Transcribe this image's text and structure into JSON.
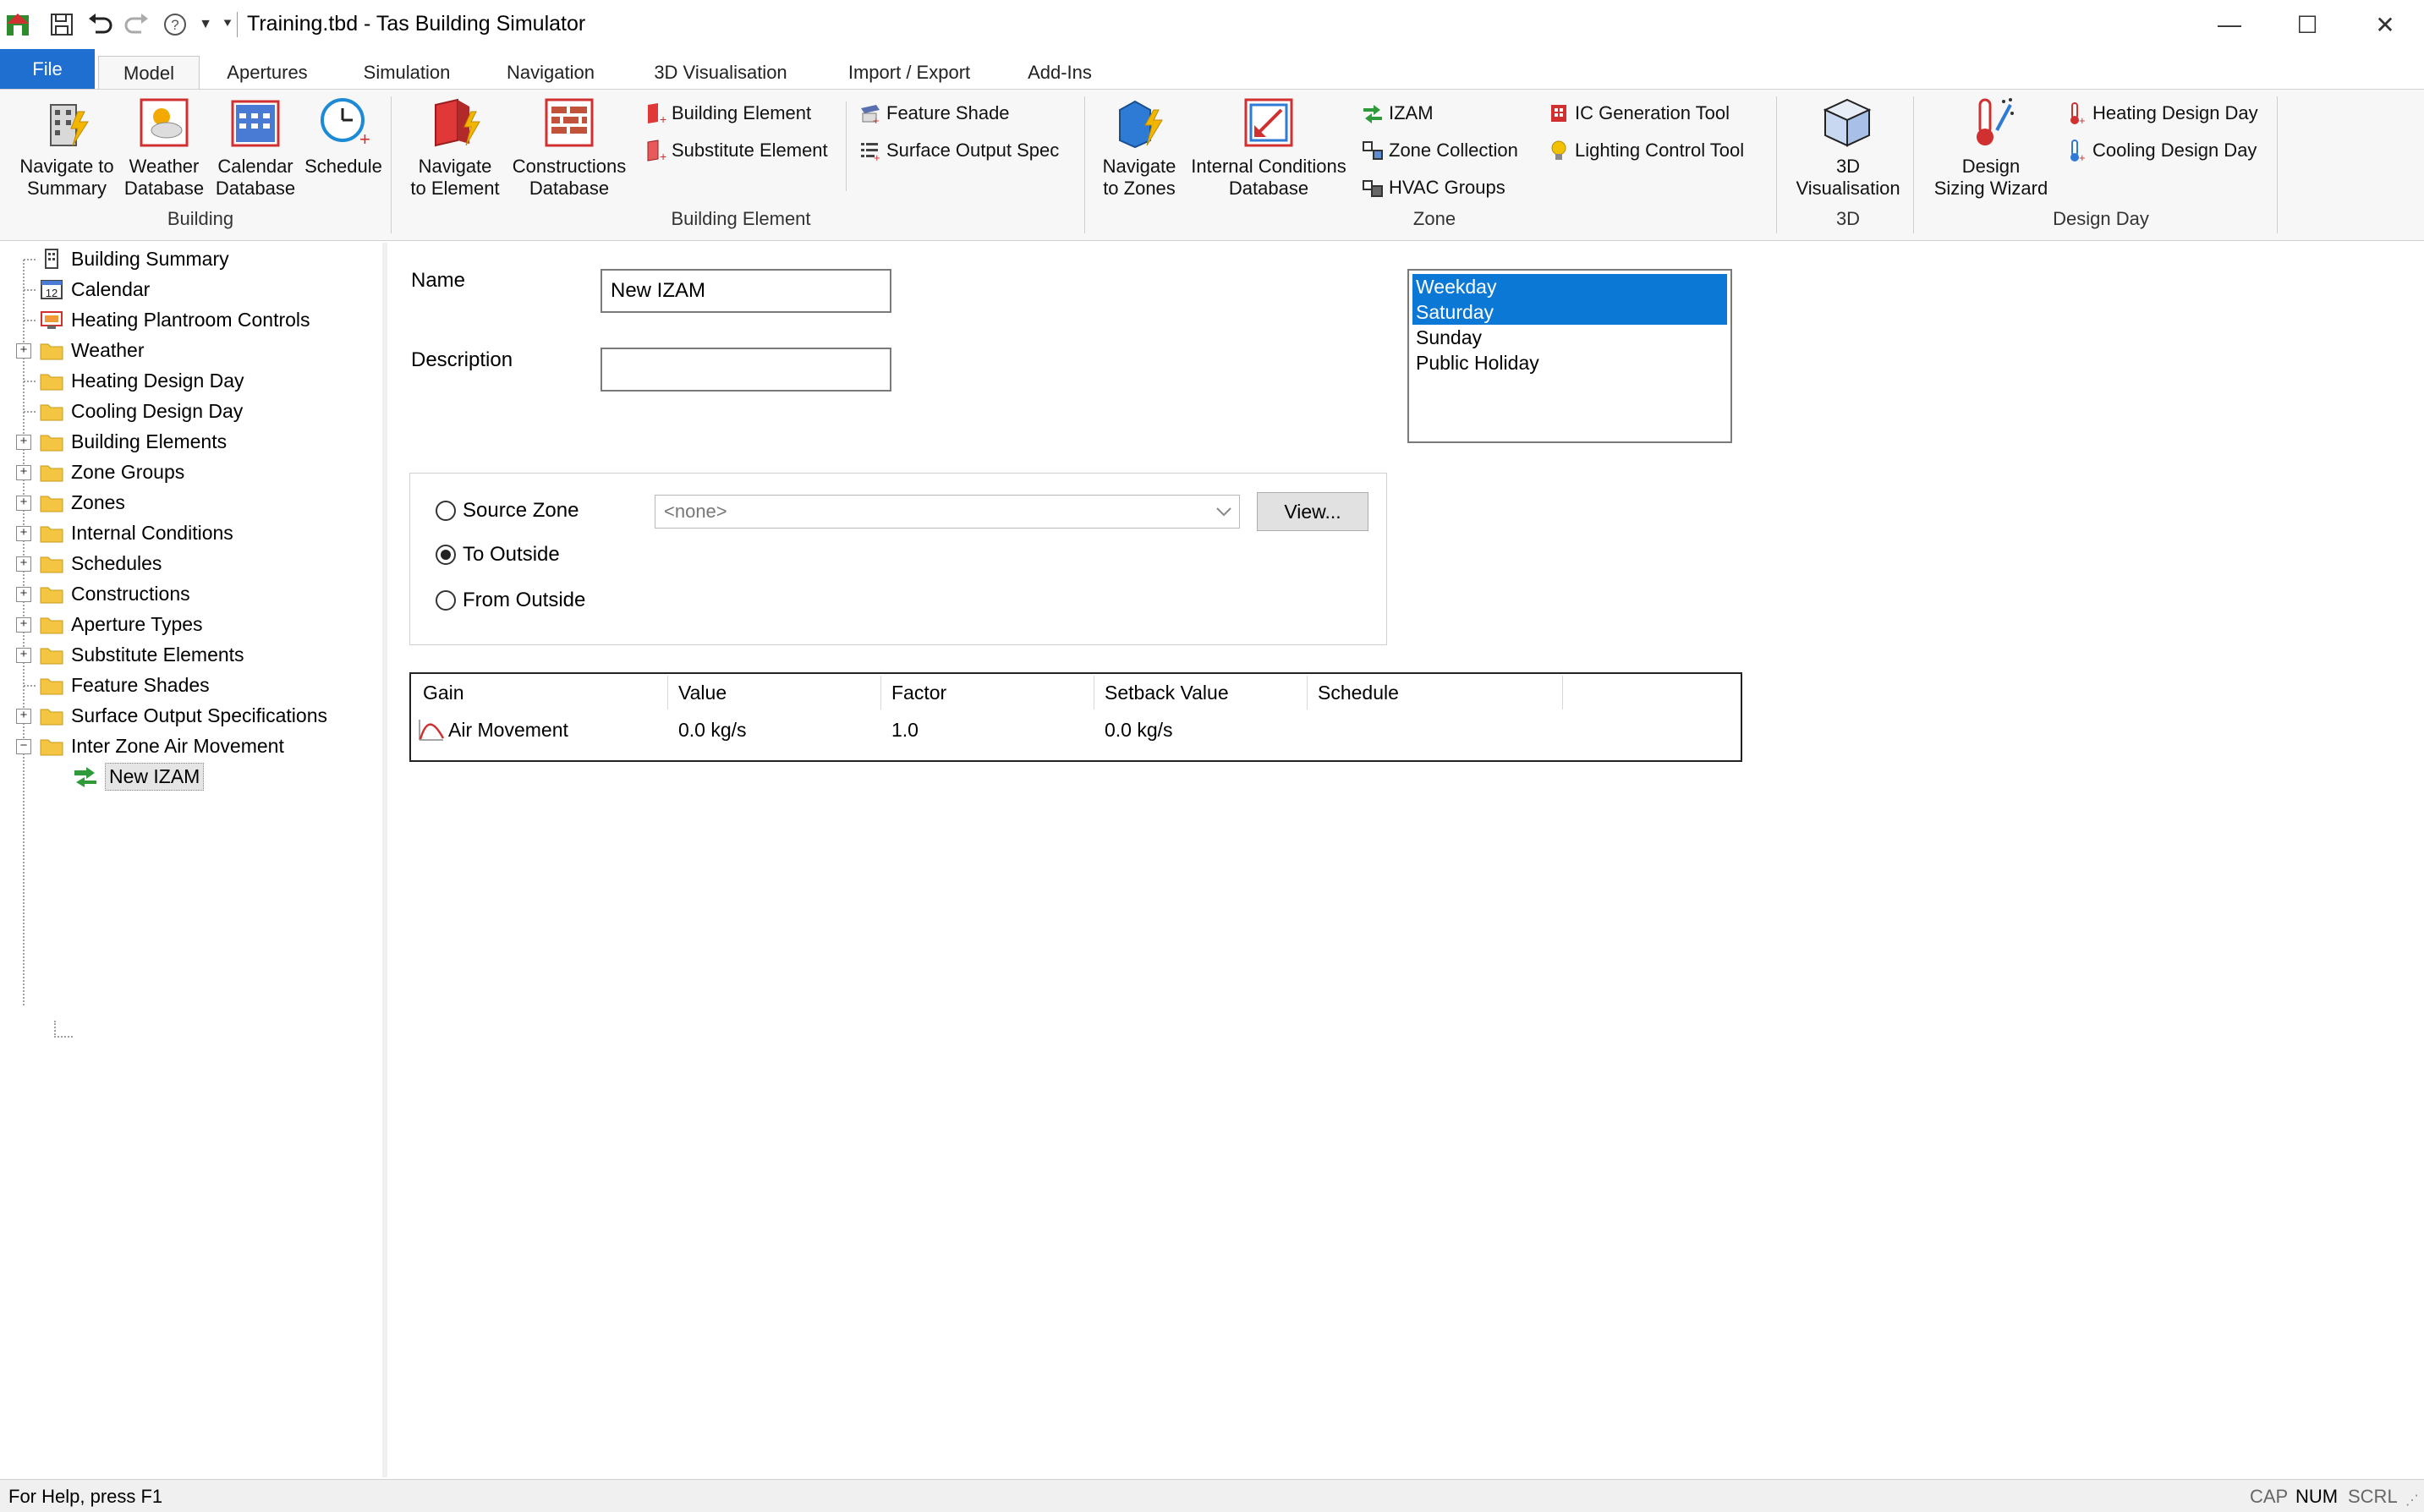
{
  "window": {
    "title": "Training.tbd - Tas Building Simulator"
  },
  "qat": {
    "icons": [
      "app-icon",
      "save-icon",
      "undo-icon",
      "redo-icon",
      "help-icon",
      "dropdown-icon",
      "customize-icon"
    ]
  },
  "window_controls": {
    "minimize": "—",
    "maximize": "☐",
    "close": "✕"
  },
  "tabs": [
    {
      "label": "File"
    },
    {
      "label": "Model"
    },
    {
      "label": "Apertures"
    },
    {
      "label": "Simulation"
    },
    {
      "label": "Navigation"
    },
    {
      "label": "3D Visualisation"
    },
    {
      "label": "Import / Export"
    },
    {
      "label": "Add-Ins"
    }
  ],
  "ribbon": {
    "building": {
      "label": "Building",
      "navigate_summary": [
        "Navigate to",
        "Summary"
      ],
      "weather_db": [
        "Weather",
        "Database"
      ],
      "calendar_db": [
        "Calendar",
        "Database"
      ],
      "schedule": [
        "Schedule",
        ""
      ]
    },
    "building_element": {
      "label": "Building Element",
      "navigate_element": [
        "Navigate",
        "to Element"
      ],
      "constructions_db": [
        "Constructions",
        "Database"
      ],
      "building_element": "Building Element",
      "substitute_element": "Substitute Element",
      "feature_shade": "Feature Shade",
      "surface_output_spec": "Surface Output Spec"
    },
    "zone": {
      "label": "Zone",
      "navigate_zones": [
        "Navigate",
        "to Zones"
      ],
      "internal_conditions_db": [
        "Internal Conditions",
        "Database"
      ],
      "izam": "IZAM",
      "zone_collection": "Zone Collection",
      "hvac_groups": "HVAC Groups",
      "ic_generation_tool": "IC Generation Tool",
      "lighting_control_tool": "Lighting Control Tool"
    },
    "three_d": {
      "label": "3D",
      "visualisation": [
        "3D",
        "Visualisation"
      ]
    },
    "design_day": {
      "label": "Design Day",
      "sizing_wizard": [
        "Design",
        "Sizing Wizard"
      ],
      "heating_design_day": "Heating Design Day",
      "cooling_design_day": "Cooling Design Day"
    }
  },
  "tree": {
    "items": [
      {
        "label": "Building Summary"
      },
      {
        "label": "Calendar"
      },
      {
        "label": "Heating Plantroom Controls"
      },
      {
        "label": "Weather"
      },
      {
        "label": "Heating Design Day"
      },
      {
        "label": "Cooling Design Day"
      },
      {
        "label": "Building Elements"
      },
      {
        "label": "Zone Groups"
      },
      {
        "label": "Zones"
      },
      {
        "label": "Internal Conditions"
      },
      {
        "label": "Schedules"
      },
      {
        "label": "Constructions"
      },
      {
        "label": "Aperture Types"
      },
      {
        "label": "Substitute Elements"
      },
      {
        "label": "Feature Shades"
      },
      {
        "label": "Surface Output Specifications"
      },
      {
        "label": "Inter Zone Air Movement"
      },
      {
        "label": "New IZAM"
      }
    ],
    "calendar_badge": "12"
  },
  "form": {
    "name_label": "Name",
    "name_value": "New IZAM",
    "description_label": "Description",
    "description_value": "",
    "days": [
      {
        "label": "Weekday",
        "selected": true
      },
      {
        "label": "Saturday",
        "selected": true
      },
      {
        "label": "Sunday",
        "selected": false
      },
      {
        "label": "Public Holiday",
        "selected": false
      }
    ],
    "radios": [
      {
        "label": "Source Zone",
        "checked": false
      },
      {
        "label": "To Outside",
        "checked": true
      },
      {
        "label": "From Outside",
        "checked": false
      }
    ],
    "source_zone_value": "<none>",
    "view_button": "View..."
  },
  "grid": {
    "headers": [
      "Gain",
      "Value",
      "Factor",
      "Setback Value",
      "Schedule"
    ],
    "rows": [
      {
        "gain": "Air Movement",
        "value": "0.0 kg/s",
        "factor": "1.0",
        "setback": "0.0 kg/s",
        "schedule": ""
      }
    ]
  },
  "status": {
    "message": "For Help, press F1",
    "indicators": [
      {
        "label": "CAP",
        "on": false
      },
      {
        "label": "NUM",
        "on": true
      },
      {
        "label": "SCRL",
        "on": false
      }
    ]
  },
  "colors": {
    "accent": "#0c78d6",
    "file_tab": "#1f6fd1",
    "folder": "#f4c542"
  }
}
